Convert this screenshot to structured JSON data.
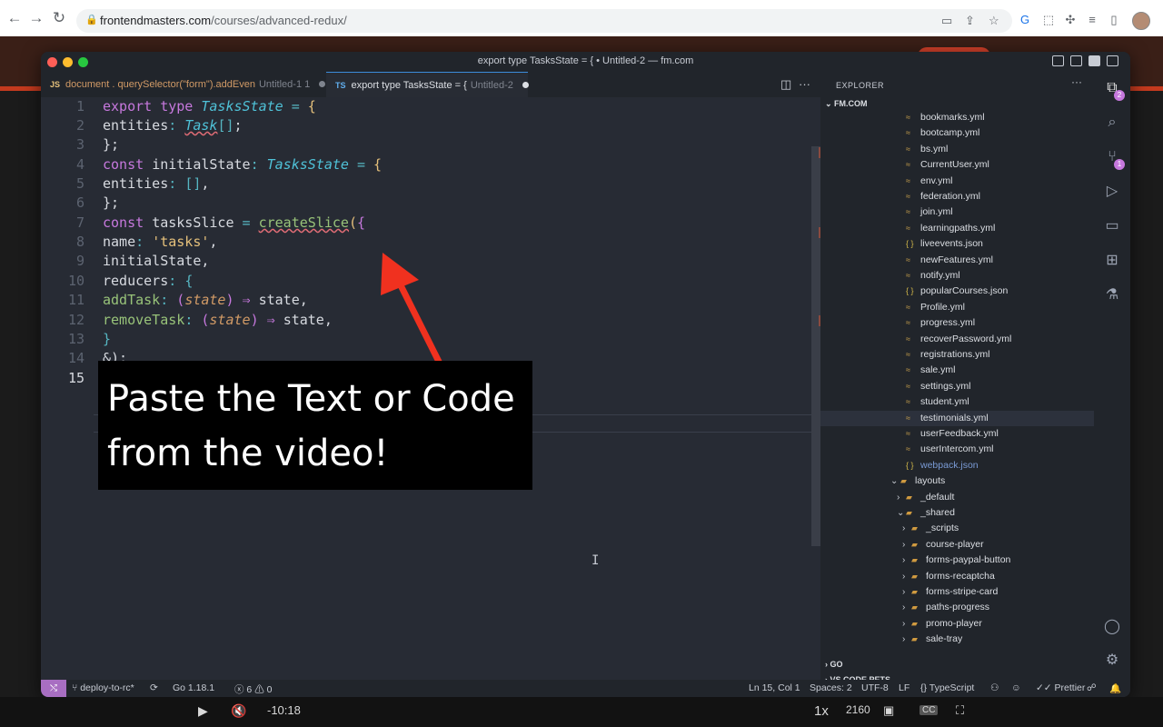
{
  "browser": {
    "back": "←",
    "forward": "→",
    "reload": "↻",
    "url_domain": "frontendmasters.com",
    "url_path": "/courses/advanced-redux/"
  },
  "window": {
    "title": "export type TasksState = { • Untitled-2 — fm.com"
  },
  "tabs": [
    {
      "lang": "JS",
      "label": "document . querySelector(\"form\").addEven",
      "desc": "Untitled-1 1"
    },
    {
      "lang": "TS",
      "label": "export type TasksState = {",
      "desc": "Untitled-2"
    }
  ],
  "editor": {
    "line_numbers": [
      "1",
      "2",
      "3",
      "4",
      "5",
      "6",
      "7",
      "8",
      "9",
      "10",
      "11",
      "12",
      "13",
      "14",
      "15"
    ],
    "lines": {
      "l1": [
        "export",
        "type",
        "TasksState",
        "=",
        "{"
      ],
      "l2": [
        "entities",
        ":",
        "Task",
        "[]",
        ";"
      ],
      "l3": [
        "};"
      ],
      "l4": [
        "const",
        "initialState",
        ":",
        "TasksState",
        "=",
        "{"
      ],
      "l5": [
        "entities",
        ":",
        "[]",
        ","
      ],
      "l6": [
        "};"
      ],
      "l7": [
        "const",
        "tasksSlice",
        "=",
        "createSlice",
        "(",
        "{"
      ],
      "l8": [
        "name",
        ":",
        "'tasks'",
        ","
      ],
      "l9": [
        "initialState,"
      ],
      "l10": [
        "reducers",
        ":",
        "{"
      ],
      "l11": [
        "addTask",
        ":",
        "(",
        "state",
        ")",
        "⇒",
        "state,"
      ],
      "l12": [
        "removeTask",
        ":",
        "(",
        "state",
        ")",
        "⇒",
        "state,"
      ],
      "l13": [
        "}"
      ],
      "l14": [
        "&);"
      ]
    }
  },
  "caption": {
    "line1": "Paste the Text or Code",
    "line2": "from the video!"
  },
  "explorer": {
    "header": "EXPLORER",
    "more": "···",
    "root": "FM.COM",
    "files": [
      {
        "name": "bookmarks.yml",
        "type": "yml"
      },
      {
        "name": "bootcamp.yml",
        "type": "yml"
      },
      {
        "name": "bs.yml",
        "type": "yml"
      },
      {
        "name": "CurrentUser.yml",
        "type": "yml"
      },
      {
        "name": "env.yml",
        "type": "yml"
      },
      {
        "name": "federation.yml",
        "type": "yml"
      },
      {
        "name": "join.yml",
        "type": "yml"
      },
      {
        "name": "learningpaths.yml",
        "type": "yml"
      },
      {
        "name": "liveevents.json",
        "type": "json"
      },
      {
        "name": "newFeatures.yml",
        "type": "yml"
      },
      {
        "name": "notify.yml",
        "type": "yml"
      },
      {
        "name": "popularCourses.json",
        "type": "json"
      },
      {
        "name": "Profile.yml",
        "type": "yml"
      },
      {
        "name": "progress.yml",
        "type": "yml"
      },
      {
        "name": "recoverPassword.yml",
        "type": "yml"
      },
      {
        "name": "registrations.yml",
        "type": "yml"
      },
      {
        "name": "sale.yml",
        "type": "yml"
      },
      {
        "name": "settings.yml",
        "type": "yml"
      },
      {
        "name": "student.yml",
        "type": "yml"
      },
      {
        "name": "testimonials.yml",
        "type": "yml",
        "selected": true
      },
      {
        "name": "userFeedback.yml",
        "type": "yml"
      },
      {
        "name": "userIntercom.yml",
        "type": "yml"
      },
      {
        "name": "webpack.json",
        "type": "json"
      }
    ],
    "folders": {
      "layouts": "layouts",
      "default": "_default",
      "shared": "_shared",
      "shared_children": [
        "_scripts",
        "course-player",
        "forms-paypal-button",
        "forms-recaptcha",
        "forms-stripe-card",
        "paths-progress",
        "promo-player",
        "sale-tray"
      ]
    },
    "sections": [
      "GO",
      "VS CODE PETS"
    ]
  },
  "activity": {
    "explorer_badge": "2",
    "scm_badge": "1"
  },
  "status": {
    "branch": "deploy-to-rc*",
    "go": "Go 1.18.1",
    "errors": "6",
    "warnings": "0",
    "position": "Ln 15, Col 1",
    "spaces": "Spaces: 2",
    "encoding": "UTF-8",
    "eol": "LF",
    "language": "TypeScript",
    "prettier": "Prettier"
  },
  "video": {
    "time": "-10:18",
    "speed": "1x",
    "quality": "2160",
    "cc": "CC"
  },
  "colors": {
    "accent_purple": "#c678dd",
    "arrow_red": "#f0311f",
    "remote_button": "#a86ec2"
  }
}
